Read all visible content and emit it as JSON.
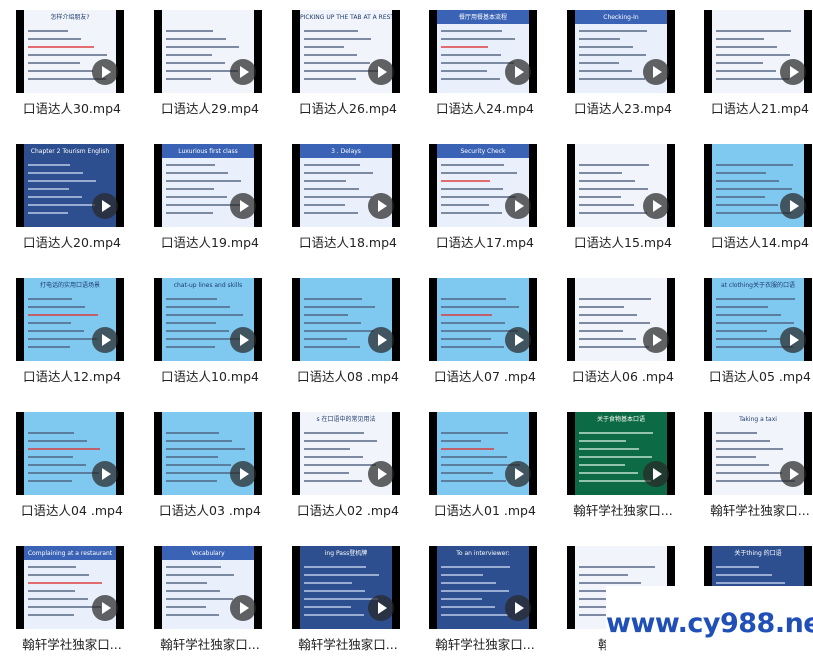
{
  "files": [
    {
      "name": "口语达人30.mp4",
      "thumb_title": "怎样介绍朋友?",
      "style": "light"
    },
    {
      "name": "口语达人29.mp4",
      "thumb_title": "",
      "style": "light"
    },
    {
      "name": "口语达人26.mp4",
      "thumb_title": "PICKING UP THE TAB AT A RESTAURANT",
      "style": "light"
    },
    {
      "name": "口语达人24.mp4",
      "thumb_title": "餐厅用餐基本流程",
      "style": "blue"
    },
    {
      "name": "口语达人23.mp4",
      "thumb_title": "Checking-In",
      "style": "blue"
    },
    {
      "name": "口语达人21.mp4",
      "thumb_title": "",
      "style": "light"
    },
    {
      "name": "口语达人20.mp4",
      "thumb_title": "Chapter 2 Tourism English",
      "style": "dark"
    },
    {
      "name": "口语达人19.mp4",
      "thumb_title": "Luxurious first class",
      "style": "blue"
    },
    {
      "name": "口语达人18.mp4",
      "thumb_title": "3 . Delays",
      "style": "blue"
    },
    {
      "name": "口语达人17.mp4",
      "thumb_title": "Security Check",
      "style": "blue"
    },
    {
      "name": "口语达人15.mp4",
      "thumb_title": "",
      "style": "light"
    },
    {
      "name": "口语达人14.mp4",
      "thumb_title": "",
      "style": "cyan"
    },
    {
      "name": "口语达人12.mp4",
      "thumb_title": "打电话的实用口语场景",
      "style": "cyan"
    },
    {
      "name": "口语达人10.mp4",
      "thumb_title": "chat-up lines and skills",
      "style": "cyan"
    },
    {
      "name": "口语达人08 .mp4",
      "thumb_title": "",
      "style": "cyan"
    },
    {
      "name": "口语达人07 .mp4",
      "thumb_title": "",
      "style": "cyan"
    },
    {
      "name": "口语达人06 .mp4",
      "thumb_title": "",
      "style": "light"
    },
    {
      "name": "口语达人05 .mp4",
      "thumb_title": "at clothing关于衣服的口语",
      "style": "cyan"
    },
    {
      "name": "口语达人04 .mp4",
      "thumb_title": "",
      "style": "cyan"
    },
    {
      "name": "口语达人03 .mp4",
      "thumb_title": "",
      "style": "cyan"
    },
    {
      "name": "口语达人02 .mp4",
      "thumb_title": "s 在口语中的常见用法",
      "style": "light"
    },
    {
      "name": "口语达人01 .mp4",
      "thumb_title": "",
      "style": "cyan"
    },
    {
      "name": "翰轩学社独家口...",
      "thumb_title": "关于食物基本口语",
      "style": "green"
    },
    {
      "name": "翰轩学社独家口...",
      "thumb_title": "Taking a taxi",
      "style": "light"
    },
    {
      "name": "翰轩学社独家口...",
      "thumb_title": "Complaining at a restaurant",
      "style": "blue"
    },
    {
      "name": "翰轩学社独家口...",
      "thumb_title": "Vocabulary",
      "style": "blue"
    },
    {
      "name": "翰轩学社独家口...",
      "thumb_title": "ing Pass登机牌",
      "style": "dark"
    },
    {
      "name": "翰轩学社独家口...",
      "thumb_title": "To an interviewer:",
      "style": "dark"
    },
    {
      "name": "翰轩学社",
      "thumb_title": "",
      "style": "light"
    },
    {
      "name": "翰轩学社独家口...",
      "thumb_title": "关于thing 的口语",
      "style": "dark"
    }
  ],
  "watermark": "www.cy988.net",
  "colors": {
    "watermark": "#1f4fb7",
    "label_text": "#222222"
  }
}
